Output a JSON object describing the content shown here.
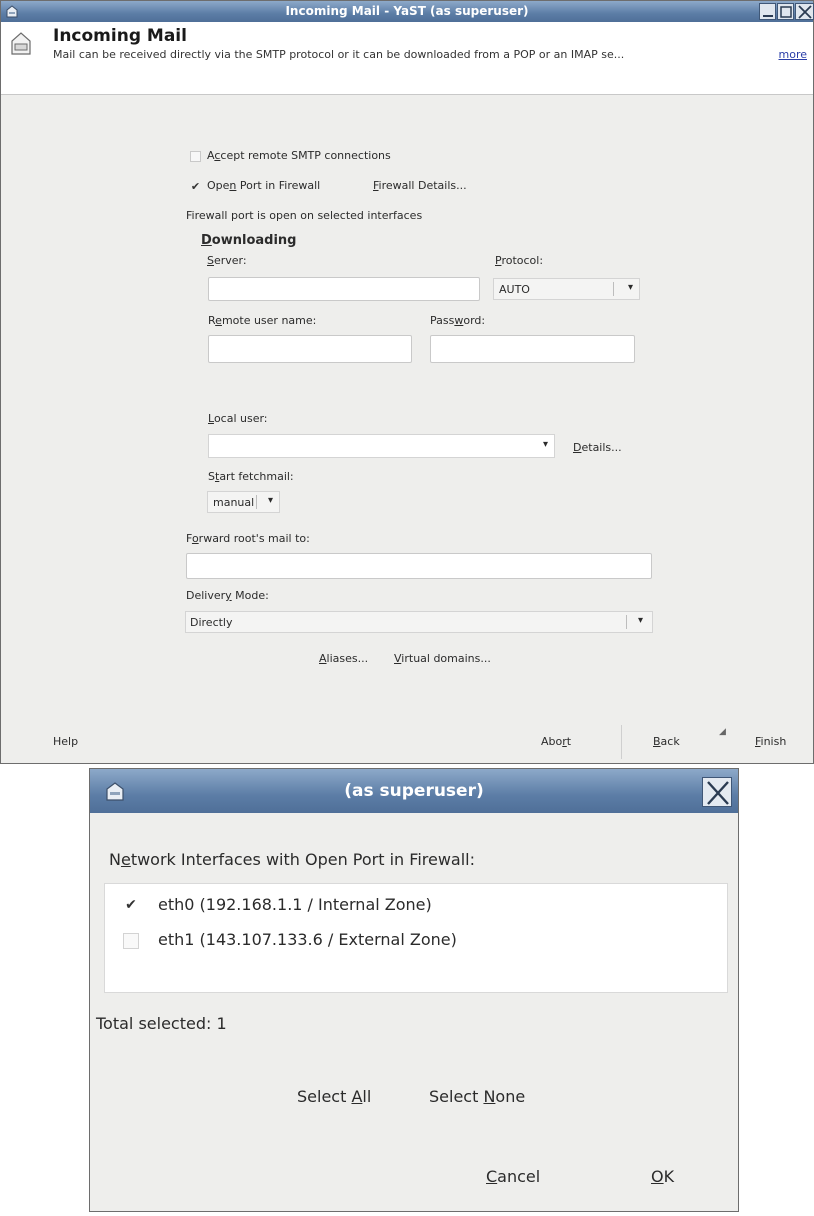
{
  "main_window": {
    "title": "Incoming Mail - YaST (as superuser)",
    "header": {
      "title": "Incoming Mail",
      "description": "Mail can be received directly via the SMTP protocol or it can be downloaded from a POP or an IMAP se...",
      "more_link": "more"
    },
    "accept_smtp": {
      "label_pre": "A",
      "label_u": "c",
      "label_post": "cept remote SMTP connections",
      "checked": false
    },
    "open_port": {
      "label_pre": "Ope",
      "label_u": "n",
      "label_post": " Port in Firewall",
      "checked": true
    },
    "firewall_details": {
      "u": "F",
      "rest": "irewall Details..."
    },
    "firewall_status": "Firewall port is open on selected interfaces",
    "downloading": {
      "heading_u": "D",
      "heading_rest": "ownloading",
      "server_label_u": "S",
      "server_label_rest": "erver:",
      "server_value": "",
      "protocol_label_u": "P",
      "protocol_label_rest": "rotocol:",
      "protocol_value": "AUTO",
      "remote_user_label_pre": "R",
      "remote_user_label_u": "e",
      "remote_user_label_rest": "mote user name:",
      "remote_user_value": "",
      "password_label_pre": "Pass",
      "password_label_u": "w",
      "password_label_rest": "ord:",
      "password_value": "",
      "local_user_label_u": "L",
      "local_user_label_rest": "ocal user:",
      "local_user_value": "",
      "details_u": "D",
      "details_rest": "etails...",
      "start_fetchmail_label_pre": "S",
      "start_fetchmail_label_u": "t",
      "start_fetchmail_label_rest": "art fetchmail:",
      "start_fetchmail_value": "manual"
    },
    "forward_label_pre": "F",
    "forward_label_u": "o",
    "forward_label_rest": "rward root's mail to:",
    "forward_value": "",
    "delivery_label_pre": "Deliver",
    "delivery_label_u": "y",
    "delivery_label_rest": " Mode:",
    "delivery_value": "Directly",
    "aliases_u": "A",
    "aliases_rest": "liases...",
    "virtual_u": "V",
    "virtual_rest": "irtual domains...",
    "footer": {
      "help": "Help",
      "abort_pre": "Abo",
      "abort_u": "r",
      "abort_rest": "t",
      "back_u": "B",
      "back_rest": "ack",
      "finish_u": "F",
      "finish_rest": "inish"
    }
  },
  "dialog": {
    "title": "(as superuser)",
    "heading_pre": "N",
    "heading_u": "e",
    "heading_rest": "twork Interfaces with Open Port in Firewall:",
    "interfaces": [
      {
        "label": "eth0 (192.168.1.1 / Internal Zone)",
        "checked": true
      },
      {
        "label": "eth1 (143.107.133.6 / External Zone)",
        "checked": false
      }
    ],
    "total_selected": "Total selected: 1",
    "select_all_pre": "Select ",
    "select_all_u": "A",
    "select_all_rest": "ll",
    "select_none_pre": "Select ",
    "select_none_u": "N",
    "select_none_rest": "one",
    "cancel_u": "C",
    "cancel_rest": "ancel",
    "ok_u": "O",
    "ok_rest": "K"
  },
  "colors": {
    "titlebar": "#5c7da6",
    "window_bg": "#eeeeec",
    "link": "#2a3ea8"
  }
}
